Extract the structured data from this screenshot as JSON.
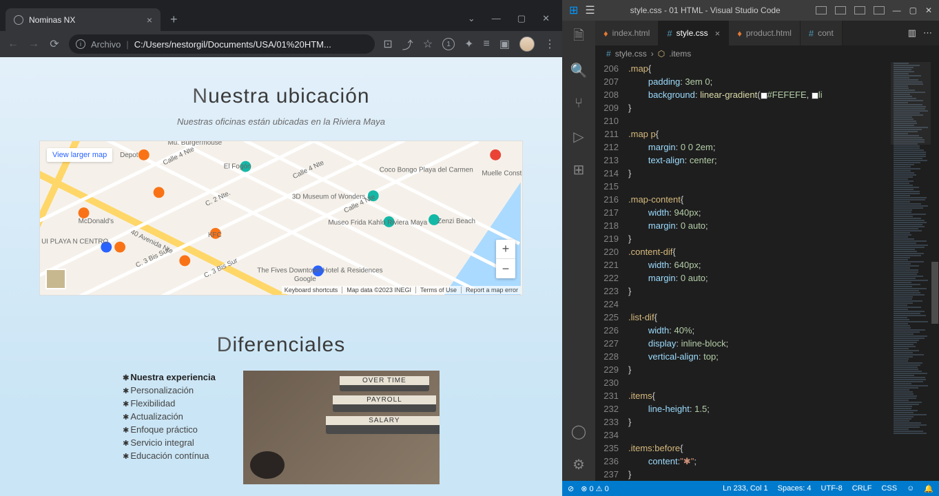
{
  "browser": {
    "tab_title": "Nominas NX",
    "url_label": "Archivo",
    "url_path": "C:/Users/nestorgil/Documents/USA/01%20HTM...",
    "badge": "1"
  },
  "page": {
    "location_title_first": "N",
    "location_title_rest": "uestra ubicación",
    "location_subtitle": "Nuestras oficinas están ubicadas en la Riviera Maya",
    "map": {
      "view_larger": "View larger map",
      "credits": [
        "Keyboard shortcuts",
        "Map data ©2023 INEGI",
        "Terms of Use",
        "Report a map error"
      ],
      "pois": [
        "Mu. Burgermouse",
        "Depot",
        "El Fogón",
        "Coco Bongo Playa del Carmen",
        "Muelle Constituyentes",
        "3D Museum of Wonders",
        "McDonald's",
        "Zenzi Beach",
        "Museo Frida Kahlo Riviera Maya",
        "KFC",
        "UI PLAYA N CENTRO",
        "The Fives Downtown Hotel & Residences"
      ],
      "streets": [
        "Calle 4 Nte",
        "Calle 4 Nte",
        "C. 2 Nte.",
        "C. 2 Nte.",
        "Calle 4 Nte",
        "Calle 4 Nte",
        "40 Avenida Nte",
        "C. 3 Bis Sur",
        "C. 3 Bis Sur",
        "C. 3 Bis Sur"
      ],
      "brand": "Google"
    },
    "diff_title_first": "D",
    "diff_title_rest": "iferenciales",
    "diff_items": [
      "Nuestra experiencia",
      "Personalización",
      "Flexibilidad",
      "Actualización",
      "Enfoque práctico",
      "Servicio integral",
      "Educación contínua"
    ],
    "binder_labels": [
      "OVER TIME",
      "PAYROLL",
      "SALARY"
    ]
  },
  "vscode": {
    "window_title": "style.css - 01 HTML - Visual Studio Code",
    "tabs": [
      {
        "name": "index.html",
        "icon": "html",
        "active": false
      },
      {
        "name": "style.css",
        "icon": "css",
        "active": true
      },
      {
        "name": "product.html",
        "icon": "html",
        "active": false
      },
      {
        "name": "cont",
        "icon": "css",
        "active": false
      }
    ],
    "breadcrumb": {
      "file": "style.css",
      "symbol": ".items"
    },
    "code_lines": [
      {
        "n": 206,
        "t": ".map",
        "indent": 0,
        "type": "sel-open"
      },
      {
        "n": 207,
        "t": "padding: 3em 0;",
        "indent": 2,
        "type": "decl",
        "prop": "padding",
        "val": "3em 0"
      },
      {
        "n": 208,
        "t": "background: linear-gradient(#FEFEFE, li",
        "indent": 2,
        "type": "grad"
      },
      {
        "n": 209,
        "t": "}",
        "indent": 0,
        "type": "close"
      },
      {
        "n": 210,
        "t": "",
        "indent": 0,
        "type": "empty"
      },
      {
        "n": 211,
        "t": ".map p{",
        "indent": 0,
        "type": "sel-open"
      },
      {
        "n": 212,
        "t": "margin: 0 0 2em;",
        "indent": 2,
        "type": "decl",
        "prop": "margin",
        "val": "0 0 2em"
      },
      {
        "n": 213,
        "t": "text-align: center;",
        "indent": 2,
        "type": "decl",
        "prop": "text-align",
        "val": "center"
      },
      {
        "n": 214,
        "t": "}",
        "indent": 0,
        "type": "close"
      },
      {
        "n": 215,
        "t": "",
        "indent": 0,
        "type": "empty"
      },
      {
        "n": 216,
        "t": ".map-content{",
        "indent": 0,
        "type": "sel-open"
      },
      {
        "n": 217,
        "t": "width: 940px;",
        "indent": 2,
        "type": "decl",
        "prop": "width",
        "val": "940px"
      },
      {
        "n": 218,
        "t": "margin: 0 auto;",
        "indent": 2,
        "type": "decl",
        "prop": "margin",
        "val": "0 auto"
      },
      {
        "n": 219,
        "t": "}",
        "indent": 0,
        "type": "close"
      },
      {
        "n": 220,
        "t": ".content-dif{",
        "indent": 0,
        "type": "sel-open"
      },
      {
        "n": 221,
        "t": "width: 640px;",
        "indent": 2,
        "type": "decl",
        "prop": "width",
        "val": "640px"
      },
      {
        "n": 222,
        "t": "margin: 0 auto;",
        "indent": 2,
        "type": "decl",
        "prop": "margin",
        "val": "0 auto"
      },
      {
        "n": 223,
        "t": "}",
        "indent": 0,
        "type": "close"
      },
      {
        "n": 224,
        "t": "",
        "indent": 0,
        "type": "empty"
      },
      {
        "n": 225,
        "t": ".list-dif{",
        "indent": 0,
        "type": "sel-open"
      },
      {
        "n": 226,
        "t": "width: 40%;",
        "indent": 2,
        "type": "decl",
        "prop": "width",
        "val": "40%"
      },
      {
        "n": 227,
        "t": "display: inline-block;",
        "indent": 2,
        "type": "decl",
        "prop": "display",
        "val": "inline-block"
      },
      {
        "n": 228,
        "t": "vertical-align: top;",
        "indent": 2,
        "type": "decl",
        "prop": "vertical-align",
        "val": "top"
      },
      {
        "n": 229,
        "t": "}",
        "indent": 0,
        "type": "close"
      },
      {
        "n": 230,
        "t": "",
        "indent": 0,
        "type": "empty"
      },
      {
        "n": 231,
        "t": ".items{",
        "indent": 0,
        "type": "sel-open"
      },
      {
        "n": 232,
        "t": "line-height: 1.5;",
        "indent": 2,
        "type": "decl",
        "prop": "line-height",
        "val": "1.5"
      },
      {
        "n": 233,
        "t": "}",
        "indent": 0,
        "type": "close"
      },
      {
        "n": 234,
        "t": "",
        "indent": 0,
        "type": "empty"
      },
      {
        "n": 235,
        "t": ".items:before{",
        "indent": 0,
        "type": "sel-open"
      },
      {
        "n": 236,
        "t": "content:\"*\";",
        "indent": 2,
        "type": "decl-str",
        "prop": "content",
        "val": "\"✱\""
      },
      {
        "n": 237,
        "t": "}",
        "indent": 0,
        "type": "close"
      },
      {
        "n": 238,
        "t": "",
        "indent": 0,
        "type": "empty"
      }
    ],
    "statusbar": {
      "errors": "0",
      "warnings": "0",
      "position": "Ln 233, Col 1",
      "spaces": "Spaces: 4",
      "encoding": "UTF-8",
      "eol": "CRLF",
      "lang": "CSS"
    }
  }
}
